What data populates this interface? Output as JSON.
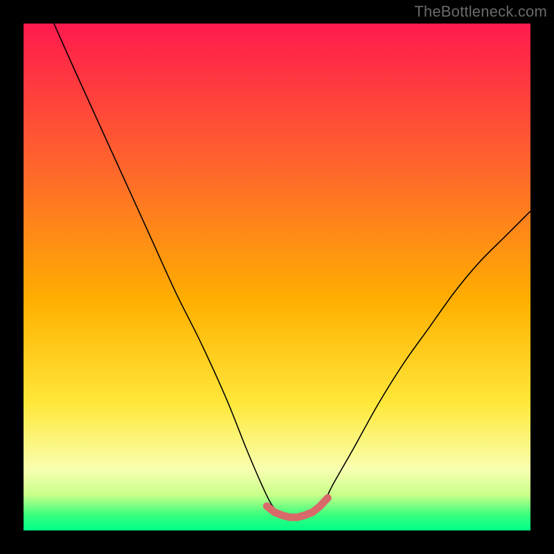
{
  "watermark": "TheBottleneck.com",
  "chart_data": {
    "type": "line",
    "title": "",
    "xlabel": "",
    "ylabel": "",
    "xlim": [
      0,
      100
    ],
    "ylim": [
      0,
      100
    ],
    "grid": false,
    "background_gradient": {
      "direction": "vertical",
      "stops": [
        {
          "offset": 0.0,
          "color": "#ff1a4d"
        },
        {
          "offset": 0.3,
          "color": "#ff6a2a"
        },
        {
          "offset": 0.55,
          "color": "#ffb000"
        },
        {
          "offset": 0.75,
          "color": "#ffe83a"
        },
        {
          "offset": 0.88,
          "color": "#f8ffb0"
        },
        {
          "offset": 0.93,
          "color": "#c8ff8a"
        },
        {
          "offset": 0.97,
          "color": "#37ff7d"
        },
        {
          "offset": 1.0,
          "color": "#00ff88"
        }
      ]
    },
    "series": [
      {
        "name": "bottleneck-curve",
        "color": "#000000",
        "stroke_width": 1.6,
        "x": [
          6,
          10,
          15,
          20,
          25,
          30,
          35,
          40,
          44,
          47,
          49,
          51,
          53,
          55,
          57,
          59,
          61,
          65,
          70,
          75,
          80,
          85,
          90,
          95,
          100
        ],
        "y": [
          100,
          91,
          80,
          69,
          58,
          47,
          37,
          26,
          16,
          9,
          5,
          3,
          2.5,
          2.5,
          3,
          5,
          9,
          16,
          25,
          33,
          40,
          47,
          53,
          58,
          63
        ]
      }
    ],
    "annotations": [
      {
        "name": "valley-marker",
        "type": "points",
        "color": "#d96a6a",
        "radius": 5,
        "x": [
          48,
          49.5,
          51,
          52.5,
          54,
          55.5,
          57,
          58.5,
          60
        ],
        "y": [
          4.8,
          3.6,
          3.0,
          2.6,
          2.6,
          3.0,
          3.6,
          4.8,
          6.4
        ]
      }
    ]
  }
}
